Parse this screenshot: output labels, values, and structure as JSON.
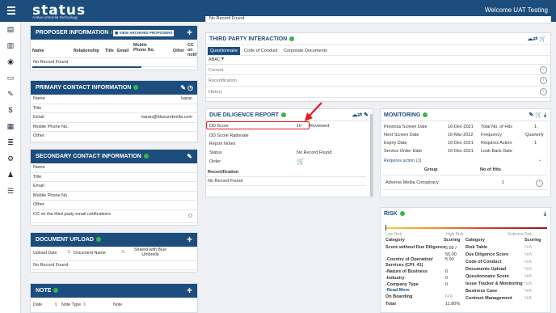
{
  "header": {
    "logo": "status",
    "logo_sub": "A Blue Umbrella Technology",
    "welcome": "Welcome UAT Testing"
  },
  "sidebar": {
    "icons": [
      "dashboard-icon",
      "building-icon",
      "eye-icon",
      "monitor-icon",
      "pen-icon",
      "dollar-icon",
      "document-icon",
      "stack-icon",
      "gear-icon",
      "user-check-icon",
      "list-icon"
    ]
  },
  "proposer": {
    "title": "PROPOSER INFORMATION",
    "archived_btn": "VIEW ARCHIVED PROPOSERS",
    "columns": [
      "Name",
      "Relationship",
      "Title",
      "Email",
      "Mobile Phone No.",
      "Other",
      "CC on notif"
    ],
    "empty": "No Record Found"
  },
  "primary": {
    "title": "PRIMARY CONTACT INFORMATION",
    "rows": [
      {
        "k": "Name",
        "v": "karan"
      },
      {
        "k": "Title",
        "v": ""
      },
      {
        "k": "Email",
        "v": "karan@blueumbrella.com"
      },
      {
        "k": "Mobile Phone No.",
        "v": ""
      },
      {
        "k": "Other",
        "v": ""
      }
    ]
  },
  "secondary": {
    "title": "SECONDARY CONTACT INFORMATION",
    "rows": [
      "Name",
      "Title",
      "Email",
      "Mobile Phone No.",
      "Other",
      "CC on the third party email notifications"
    ]
  },
  "docs": {
    "title": "DOCUMENT UPLOAD",
    "cols": [
      "Upload Date",
      "Document Name",
      "Shared with Blue Umbrella"
    ],
    "empty": "No Record Found"
  },
  "note": {
    "title": "NOTE",
    "cols": [
      "Date",
      "Note Type",
      "Note"
    ]
  },
  "tpi": {
    "top_text": "No Record Found",
    "title": "THIRD PARTY INTERACTION",
    "tabs": [
      "Questionnaire",
      "Code of Conduct",
      "Corporate Documents"
    ],
    "select": "ABAC",
    "rows": [
      "Current",
      "Recertification",
      "History"
    ]
  },
  "dd": {
    "title": "DUE DILIGENCE REPORT",
    "rows": [
      {
        "k": "DD Score",
        "v": "10",
        "s": "Reviewed"
      },
      {
        "k": "DD Score Rationale",
        "v": ""
      },
      {
        "k": "Report Notes",
        "v": ""
      },
      {
        "k": "Status",
        "v": "No Record Found"
      },
      {
        "k": "Order",
        "v": ""
      }
    ],
    "recert": "Recertification",
    "empty": "No Record Found"
  },
  "mon": {
    "title": "MONITORING",
    "left": [
      {
        "k": "Previous Screen Date",
        "v": "16-Dec-2021"
      },
      {
        "k": "Next Screen Date",
        "v": "16-Mar-2022"
      },
      {
        "k": "Expiry Date",
        "v": "16-Dec-2021"
      },
      {
        "k": "Service Order Date",
        "v": "16-Dec-2021"
      }
    ],
    "right": [
      {
        "k": "Total No. of Hits",
        "v": "1"
      },
      {
        "k": "Frequency",
        "v": "Quarterly"
      },
      {
        "k": "Requires Action",
        "v": "1"
      },
      {
        "k": "Look Back Date",
        "v": ""
      }
    ],
    "req": "Requires action (1)",
    "group_h": "Group",
    "hits_h": "No of Hits",
    "group": "Adverse Media Conspiracy",
    "hits": "1"
  },
  "risk": {
    "title": "RISK",
    "scale": [
      "Low Risk",
      "High Risk",
      "Extreme Risk"
    ],
    "left_h": [
      "Category",
      "Scoring"
    ],
    "left": [
      {
        "k": "Score without Due Diligence",
        "v": "5.90 / 50.00"
      },
      {
        "k": "-Country of Operation/ Services (CPI: 41)",
        "v": "5.90"
      },
      {
        "k": "-Nature of Business",
        "v": "0"
      },
      {
        "k": "-Industry",
        "v": "0"
      },
      {
        "k": "-Company Type",
        "v": "0"
      },
      {
        "k": "-Read More",
        "v": ""
      },
      {
        "k": "On Boarding",
        "v": "N/A"
      },
      {
        "k": "Total",
        "v": "11.80%"
      }
    ],
    "right_h": [
      "Category",
      "Scoring"
    ],
    "right": [
      {
        "k": "Risk Table",
        "v": "N/A"
      },
      {
        "k": "Due Diligence Score",
        "v": "N/A"
      },
      {
        "k": "Code of Conduct",
        "v": "N/A"
      },
      {
        "k": "Documents Upload",
        "v": "N/A"
      },
      {
        "k": "Questionnaire Score",
        "v": "N/A"
      },
      {
        "k": "Issue Tracker & Monitoring",
        "v": "N/A"
      },
      {
        "k": "Business Case",
        "v": "N/A"
      },
      {
        "k": "Contract Management",
        "v": "N/A"
      }
    ]
  },
  "colors": {
    "navy": "#1c4d7d",
    "green": "#39b54a",
    "highlight": "#e21b1b"
  }
}
